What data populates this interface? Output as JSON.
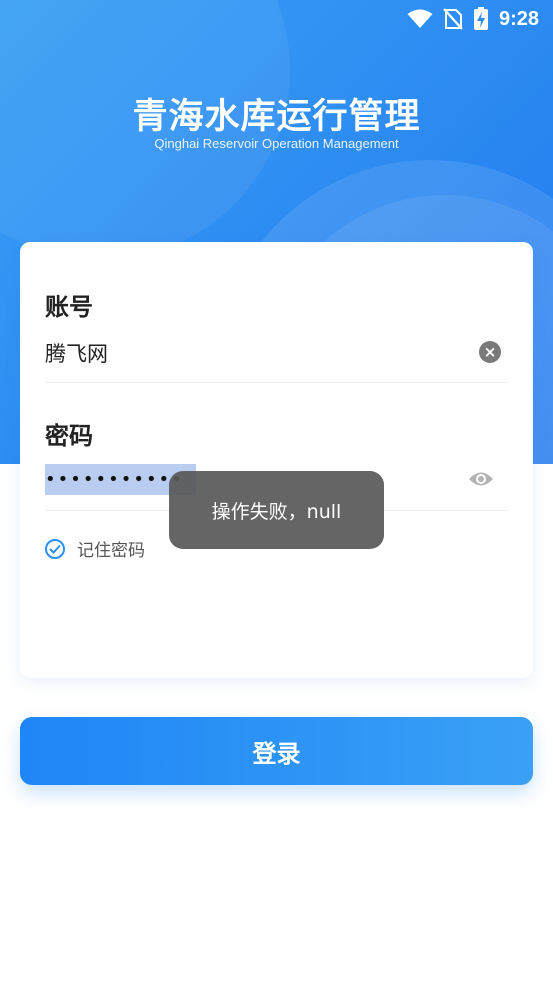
{
  "status_bar": {
    "time": "9:28"
  },
  "header": {
    "title": "青海水库运行管理",
    "subtitle": "Qinghai Reservoir Operation Management"
  },
  "form": {
    "account_label": "账号",
    "account_value": "腾飞网",
    "password_label": "密码",
    "password_value": "•••••••••••",
    "remember_label": "记住密码",
    "remember_checked": true
  },
  "toast": {
    "message": "操作失败，null"
  },
  "login_button": {
    "label": "登录"
  },
  "colors": {
    "accent": "#2f8ef2",
    "toast_bg": "#585858"
  }
}
